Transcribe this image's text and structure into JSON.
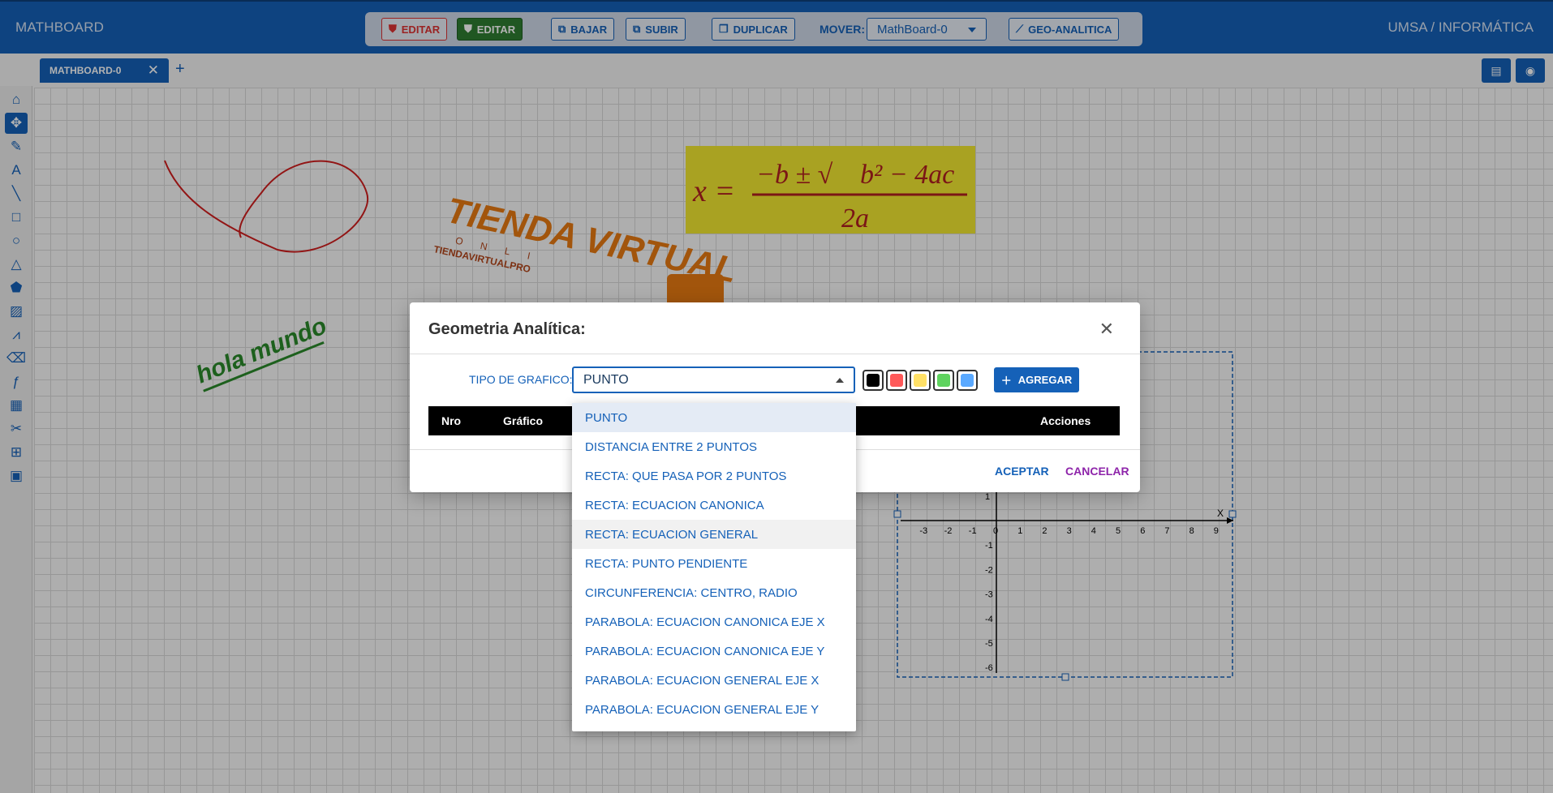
{
  "app": {
    "brand": "MATHBOARD",
    "org": "UMSA / INFORMÁTICA"
  },
  "toolbar": {
    "editar_red": "EDITAR",
    "editar_green": "EDITAR",
    "bajar": "BAJAR",
    "subir": "SUBIR",
    "duplicar": "DUPLICAR",
    "mover_label": "MOVER:",
    "mover_value": "MathBoard-0",
    "geo": "GEO-ANALITICA"
  },
  "tabs": {
    "active": "MATHBOARD-0",
    "close": "✕",
    "add": "+"
  },
  "sidebar_icons": [
    "home-icon",
    "move-icon",
    "pencil-icon",
    "text-icon",
    "line-icon",
    "rectangle-icon",
    "circle-icon",
    "triangle-icon",
    "pentagon-icon",
    "image-icon",
    "chart-icon",
    "eraser-icon",
    "function-icon",
    "calculator-icon",
    "scissors-icon",
    "table-icon",
    "save-icon"
  ],
  "modal": {
    "title": "Geometria Analítica:",
    "close": "✕",
    "tipo_label": "TIPO DE GRAFICO:",
    "tipo_value": "PUNTO",
    "add_label": "AGREGAR",
    "table_headers": [
      "Nro",
      "Gráfico",
      "Acciones"
    ],
    "accept": "ACEPTAR",
    "cancel": "CANCELAR"
  },
  "swatches": [
    "#000000",
    "#ff5a5a",
    "#ffe066",
    "#5fd35f",
    "#5aa9ff"
  ],
  "dropdown": {
    "selected_index": 0,
    "hover_index": 4,
    "options": [
      "PUNTO",
      "DISTANCIA ENTRE 2 PUNTOS",
      "RECTA: QUE PASA POR 2 PUNTOS",
      "RECTA: ECUACION CANONICA",
      "RECTA: ECUACION GENERAL",
      "RECTA: PUNTO PENDIENTE",
      "CIRCUNFERENCIA: CENTRO, RADIO",
      "PARABOLA: ECUACION CANONICA EJE X",
      "PARABOLA: ECUACION CANONICA EJE Y",
      "PARABOLA: ECUACION GENERAL EJE X",
      "PARABOLA: ECUACION GENERAL EJE Y"
    ]
  },
  "board": {
    "hola": "hola mundo",
    "formula": {
      "lhs": "x =",
      "num": "−b ± √",
      "rad": "b² − 4ac",
      "den": "2a"
    },
    "tienda": {
      "big": "TIENDA VIRTUAL",
      "sub": "ONLI",
      "url": "TIENDAVIRTUALPRO"
    },
    "graph": {
      "xticks": [
        "-3",
        "-2",
        "-1",
        "0",
        "1",
        "2",
        "3",
        "4",
        "5",
        "6",
        "7",
        "8",
        "9"
      ],
      "yticks": [
        "1",
        "-1",
        "-2",
        "-3",
        "-4",
        "-5",
        "-6"
      ],
      "xlabel": "X"
    }
  },
  "colors": {
    "primary": "#1561b8",
    "cancel": "#8e24aa"
  }
}
